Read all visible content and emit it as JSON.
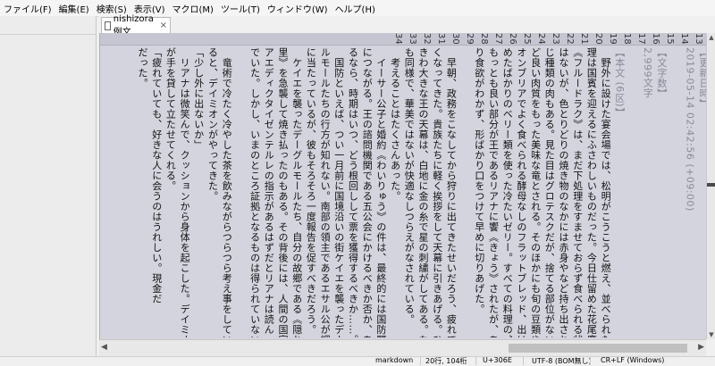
{
  "menu": [
    "ファイル(F)",
    "編集(E)",
    "検索(S)",
    "表示(V)",
    "マクロ(M)",
    "ツール(T)",
    "ウィンドウ(W)",
    "ヘルプ(H)"
  ],
  "tab": {
    "title": "nishizora例文",
    "close": "×"
  },
  "line_numbers": [
    "13",
    "14",
    "15",
    "16",
    "17",
    "18",
    "19",
    "20",
    "21",
    "22",
    "23",
    "24",
    "25",
    "26",
    "27",
    "28",
    "29",
    "30",
    "31",
    "32",
    "33",
    "34"
  ],
  "lines": [
    {
      "text": "【更新日時】",
      "kind": "meta"
    },
    {
      "text": "2019-05-14 02:42:56 (+09:00)",
      "kind": "meta"
    },
    {
      "text": "",
      "kind": "meta"
    },
    {
      "text": "【文字数】",
      "kind": "meta"
    },
    {
      "text": "2,999文字",
      "kind": "meta"
    },
    {
      "text": "",
      "kind": "meta"
    },
    {
      "text": "【本文 (6区)】",
      "kind": "meta"
    },
    {
      "text": "　野外に設けた宴会場では、松明がこうこうと燃え、並べられた料",
      "kind": "body"
    },
    {
      "text": "理は国賓を迎えるにふさわしいものだった。今日仕留めた花尾鷹",
      "kind": "body"
    },
    {
      "text": "《フルードラク》は、まだ下処理をすませておらず食べられる状態で",
      "kind": "ruby"
    },
    {
      "text": "はないが、色とりどりの焼き物のなかには赤身やなど持ち出された同",
      "kind": "body"
    },
    {
      "text": "じ種類の肉もある。見た目はグロテスクだが、捨てる部位がないほ",
      "kind": "body"
    },
    {
      "text": "ど良い肉質をもった美味な竜とされる。そのほかにも旬の豆類や、",
      "kind": "body"
    },
    {
      "text": "オンブリアでよく食べられる酵母なしのフラットブレッド、出はじ",
      "kind": "body"
    },
    {
      "text": "めたばかりのベリー類を使った冷たいゼリー。すべての料理の、",
      "kind": "body"
    },
    {
      "text": "もっとも良い部分が王であるリアナに饗《きょう》されたが、あま",
      "kind": "body"
    },
    {
      "text": "り食欲がわかず、形ばかり口をつけて早めに切りあげた。",
      "kind": "body"
    },
    {
      "text": "",
      "kind": "body"
    },
    {
      "text": "　早朝、政務をこなしてから狩りに出てきたせいだろう、疲れて眠",
      "kind": "body"
    },
    {
      "text": "くなってきた。貴族たちに軽く挨拶をして天幕に引きあげる。ひと",
      "kind": "body"
    },
    {
      "text": "きわ大きな王の天幕は、白地に金の糸で星の刺繍がしてある。なか",
      "kind": "body"
    },
    {
      "text": "も同様で、華美ではないが快適なしつらえがなされている。",
      "kind": "body"
    },
    {
      "text": "　考えることはたくさんあった。",
      "kind": "body"
    },
    {
      "text": "　イーサー公子と婚約《わいりゅう》の件は、最終的には国防問題",
      "kind": "ruby"
    },
    {
      "text": "につながる。王の諮問機関である五公会にかけるべきか否か、あげ",
      "kind": "body"
    },
    {
      "text": "るなら、時期はいつ、どう根回しして票を獲得するべきか……。",
      "kind": "body"
    },
    {
      "text": "　国防といえば、つい一月前に国境沿いの街ケイエを襲ったデーグ",
      "kind": "body"
    },
    {
      "text": "ルモールたちの行方が知れない。南部の領主であるエサル公が調査",
      "kind": "body"
    },
    {
      "text": "に当たっているが、彼もそろそろ一度報告を促すべきだろう。",
      "kind": "body"
    },
    {
      "text": "　ケイエを襲ったデーグルモールたち、自分の故郷である《隠れ",
      "kind": "body"
    },
    {
      "text": "里》を急襲して焼き払ったのもある。その背後には、人間の国家",
      "kind": "body"
    },
    {
      "text": "アエディクタイゼンテルレの指示があるはずだとリアナは読ん",
      "kind": "body"
    },
    {
      "text": "でいた。しかし、いまのところ証拠となるものは得られていない。",
      "kind": "body"
    },
    {
      "text": "",
      "kind": "body"
    },
    {
      "text": "　竜術で冷たく冷やした茶を飲みながらつらつら考え事をしてい",
      "kind": "body"
    },
    {
      "text": "ると、デイミオンがやってきた。",
      "kind": "body"
    },
    {
      "text": "「少し外に出ないか」",
      "kind": "body"
    },
    {
      "text": "　リアナは微笑んで、クッションから身体を起こした。デイミオン",
      "kind": "body"
    },
    {
      "text": "が手を貸して立たせてくれる。",
      "kind": "body"
    },
    {
      "text": "「疲れていても、好きな人に会うのはうれしい。現金だ",
      "kind": "body"
    },
    {
      "text": "だった。",
      "kind": "body"
    },
    {
      "text": "",
      "kind": "body"
    }
  ],
  "status": {
    "mode": "markdown",
    "position": "20行, 104桁",
    "codepoint": "U+306E",
    "encoding": "UTF-8 (BOM無し)",
    "eol": "CR+LF (Windows)"
  }
}
